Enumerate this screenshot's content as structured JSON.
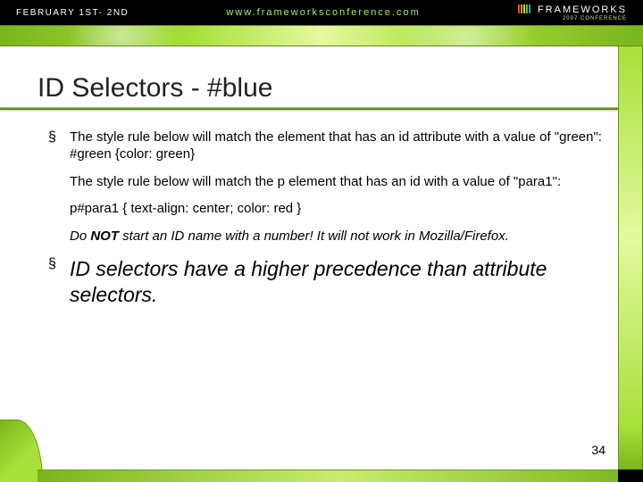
{
  "header": {
    "date": "FEBRUARY 1ST- 2ND",
    "url": "www.frameworksconference.com",
    "brand": "FRAMEWORKS",
    "subbrand": "2007 CONFERENCE"
  },
  "title": "ID Selectors -  #blue",
  "bullets": {
    "b1": {
      "p1": "The style rule below will match the element that has an id attribute with a value of \"green\":",
      "code1": "#green {color: green}",
      "p2": "The style rule below will match the p element that has an id with a value of \"para1\":",
      "code2": "p#para1 { text-align: center; color: red }",
      "note_pre": "Do ",
      "note_strong": "NOT",
      "note_post": " start an ID name with a number! It will not work in Mozilla/Firefox."
    },
    "b2": "ID selectors have a higher precedence than attribute selectors."
  },
  "page_number": "34"
}
